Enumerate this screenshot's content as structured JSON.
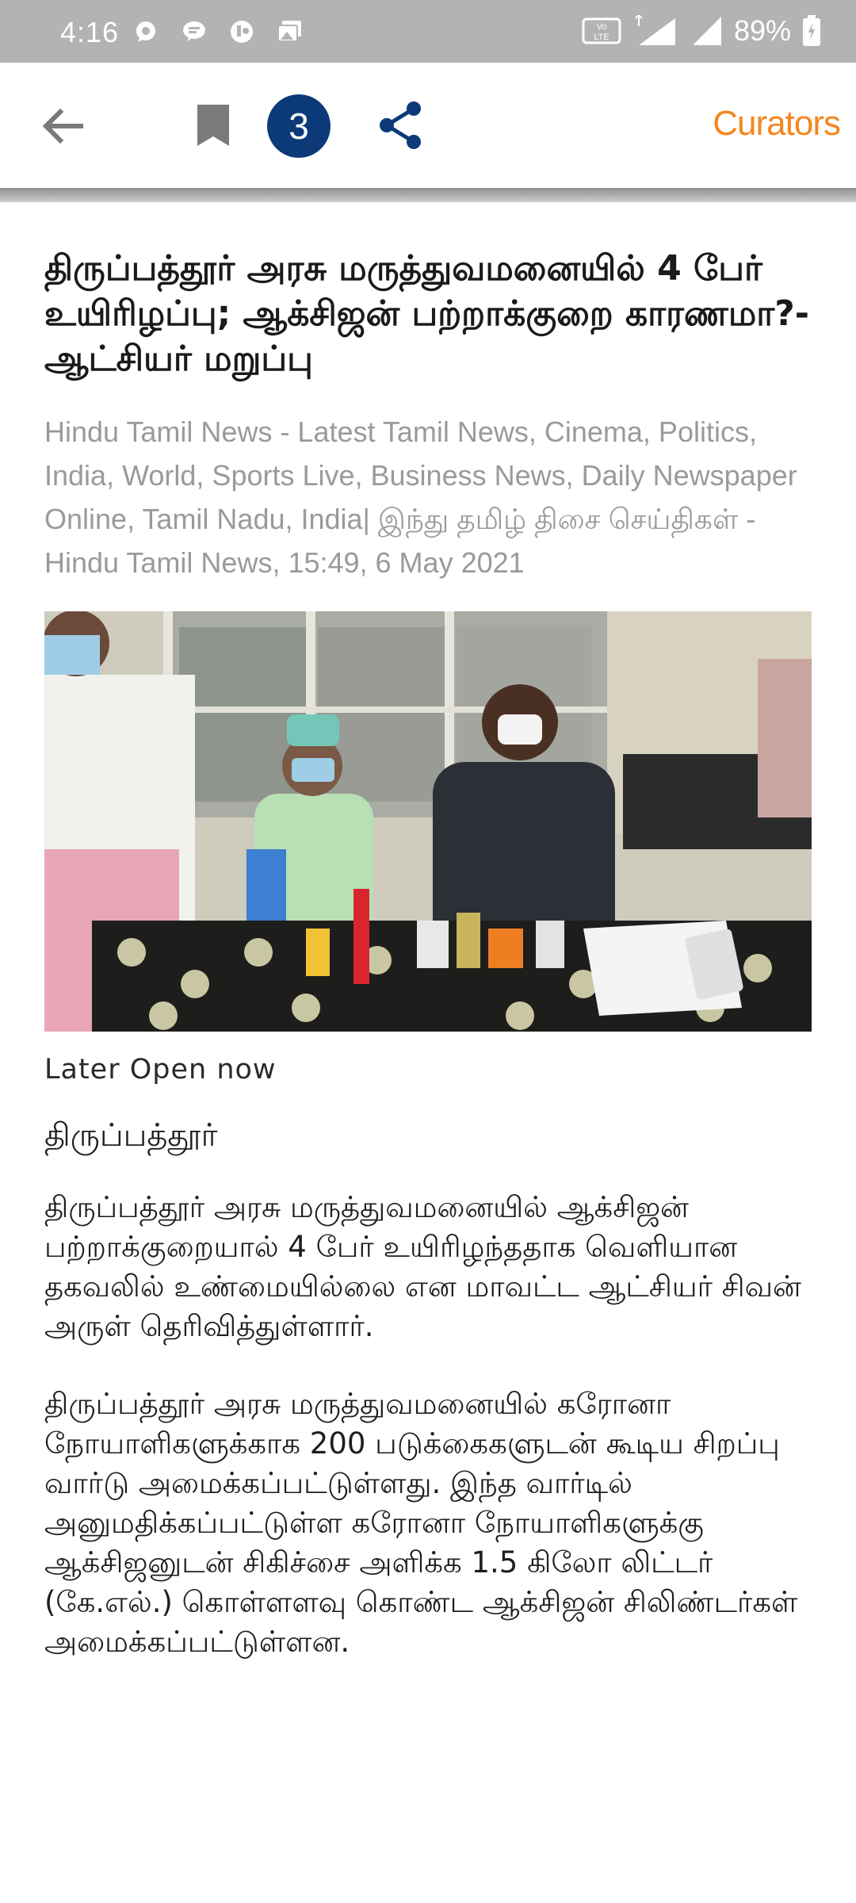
{
  "status_bar": {
    "time": "4:16",
    "battery": "89%",
    "network": "4G",
    "volte": "Vo LTE 1",
    "left_icons": [
      "whatsapp-icon",
      "message-icon",
      "app-icon",
      "gallery-icon"
    ]
  },
  "app_bar": {
    "back_icon": "arrow-back-icon",
    "bookmark_icon": "bookmark-icon",
    "count": "3",
    "share_icon": "share-icon",
    "curators_label": "Curators",
    "accent_color": "#f5861f",
    "badge_color": "#0c3a78"
  },
  "article": {
    "headline": "திருப்பத்தூர் அரசு மருத்துவமனையில் 4 பேர் உயிரிழப்பு; ஆக்சிஜன் பற்றாக்குறை காரணமா?- ஆட்சியர் மறுப்பு",
    "byline": "Hindu Tamil News - Latest Tamil News, Cinema, Politics, India, World, Sports Live, Business News, Daily Newspaper Online, Tamil Nadu, India| இந்து தமிழ் திசை செய்திகள் - Hindu Tamil News, 15:49, 6 May 2021",
    "image_alt": "press-meet-photo",
    "later_text": "Later Open now",
    "dateline": "திருப்பத்தூர்",
    "paragraphs": [
      "திருப்பத்தூர் அரசு மருத்துவமனையில் ஆக்சிஜன் பற்றாக்குறையால் 4 பேர் உயிரிழந்ததாக வெளியான தகவலில் உண்மையில்லை என மாவட்ட ஆட்சியர் சிவன் அருள் தெரிவித்துள்ளார்.",
      "திருப்பத்தூர் அரசு மருத்துவமனையில் கரோனா நோயாளிகளுக்காக 200 படுக்கைகளுடன் கூடிய சிறப்பு வார்டு அமைக்கப்பட்டுள்ளது. இந்த வார்டில் அனுமதிக்கப்பட்டுள்ள கரோனா நோயாளிகளுக்கு ஆக்சிஜனுடன் சிகிச்சை அளிக்க 1.5 கிலோ லிட்டர் (கே.எல்.) கொள்ளளவு கொண்ட ஆக்சிஜன் சிலிண்டர்கள் அமைக்கப்பட்டுள்ளன."
    ]
  }
}
